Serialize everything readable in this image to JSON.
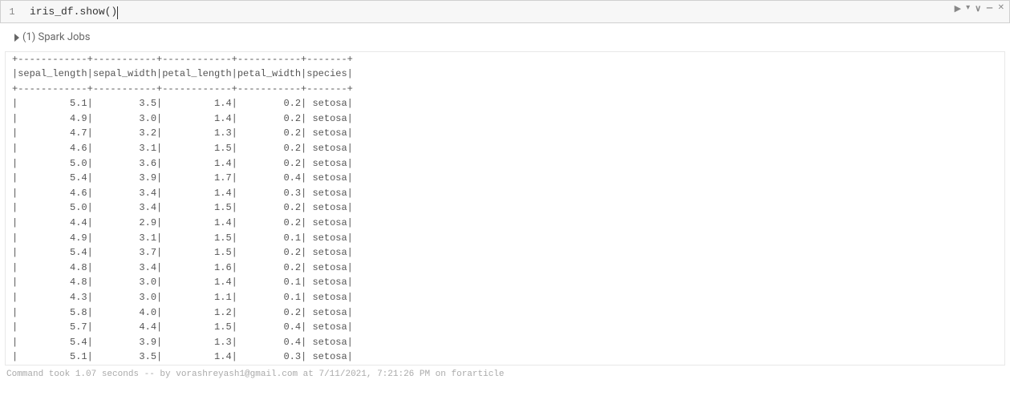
{
  "cell": {
    "line_number": "1",
    "code": "iris_df.show()"
  },
  "controls": {
    "run": "▶",
    "dropdown": "▾",
    "expand": "∨",
    "minimize": "—",
    "close": "✕"
  },
  "jobs": {
    "label": "(1) Spark Jobs"
  },
  "table": {
    "columns": [
      "sepal_length",
      "sepal_width",
      "petal_length",
      "petal_width",
      "species"
    ],
    "widths": [
      12,
      11,
      12,
      11,
      7
    ],
    "rows": [
      [
        "5.1",
        "3.5",
        "1.4",
        "0.2",
        "setosa"
      ],
      [
        "4.9",
        "3.0",
        "1.4",
        "0.2",
        "setosa"
      ],
      [
        "4.7",
        "3.2",
        "1.3",
        "0.2",
        "setosa"
      ],
      [
        "4.6",
        "3.1",
        "1.5",
        "0.2",
        "setosa"
      ],
      [
        "5.0",
        "3.6",
        "1.4",
        "0.2",
        "setosa"
      ],
      [
        "5.4",
        "3.9",
        "1.7",
        "0.4",
        "setosa"
      ],
      [
        "4.6",
        "3.4",
        "1.4",
        "0.3",
        "setosa"
      ],
      [
        "5.0",
        "3.4",
        "1.5",
        "0.2",
        "setosa"
      ],
      [
        "4.4",
        "2.9",
        "1.4",
        "0.2",
        "setosa"
      ],
      [
        "4.9",
        "3.1",
        "1.5",
        "0.1",
        "setosa"
      ],
      [
        "5.4",
        "3.7",
        "1.5",
        "0.2",
        "setosa"
      ],
      [
        "4.8",
        "3.4",
        "1.6",
        "0.2",
        "setosa"
      ],
      [
        "4.8",
        "3.0",
        "1.4",
        "0.1",
        "setosa"
      ],
      [
        "4.3",
        "3.0",
        "1.1",
        "0.1",
        "setosa"
      ],
      [
        "5.8",
        "4.0",
        "1.2",
        "0.2",
        "setosa"
      ],
      [
        "5.7",
        "4.4",
        "1.5",
        "0.4",
        "setosa"
      ],
      [
        "5.4",
        "3.9",
        "1.3",
        "0.4",
        "setosa"
      ],
      [
        "5.1",
        "3.5",
        "1.4",
        "0.3",
        "setosa"
      ]
    ],
    "right_align_species": false
  },
  "status": {
    "text": "Command took 1.07 seconds -- by vorashreyash1@gmail.com at 7/11/2021, 7:21:26 PM on forarticle"
  }
}
